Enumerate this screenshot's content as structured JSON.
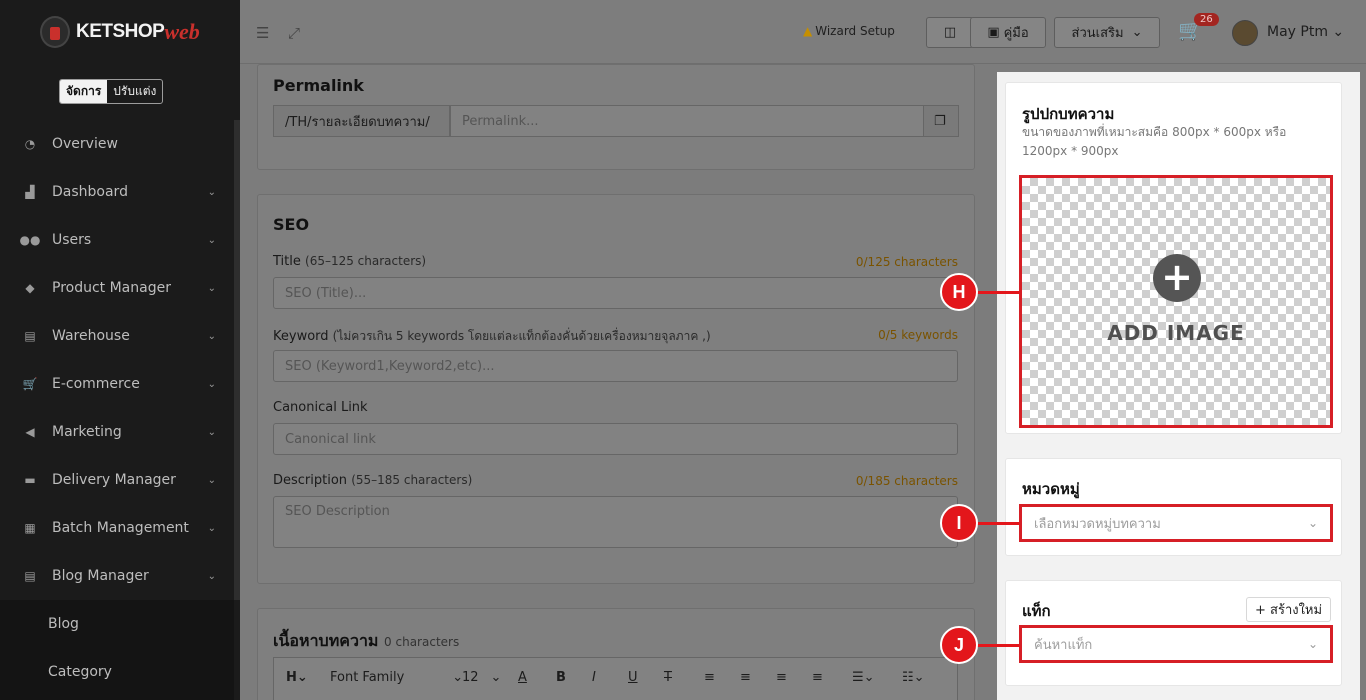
{
  "brand": {
    "name": "KETSHOP",
    "accent": "web"
  },
  "mode_toggle": {
    "manage": "จัดการ",
    "customize": "ปรับแต่ง"
  },
  "sidebar": {
    "items": [
      {
        "label": "Overview",
        "icon": "pie-chart-icon"
      },
      {
        "label": "Dashboard",
        "icon": "bar-chart-icon"
      },
      {
        "label": "Users",
        "icon": "users-icon"
      },
      {
        "label": "Product Manager",
        "icon": "tag-icon"
      },
      {
        "label": "Warehouse",
        "icon": "warehouse-icon"
      },
      {
        "label": "E-commerce",
        "icon": "cart-icon"
      },
      {
        "label": "Marketing",
        "icon": "megaphone-icon"
      },
      {
        "label": "Delivery Manager",
        "icon": "truck-icon"
      },
      {
        "label": "Batch Management",
        "icon": "boxes-icon"
      },
      {
        "label": "Blog Manager",
        "icon": "blog-icon"
      }
    ],
    "sub_items": [
      {
        "label": "Blog"
      },
      {
        "label": "Category"
      }
    ]
  },
  "topbar": {
    "wizard": "Wizard Setup",
    "manual": "คู่มือ",
    "addons": "ส่วนเสริม",
    "cart_count": "26",
    "user": "May Ptm"
  },
  "permalink": {
    "title": "Permalink",
    "prefix": "/TH/รายละเอียดบทความ/",
    "placeholder": "Permalink..."
  },
  "seo": {
    "title": "SEO",
    "title_label": "Title",
    "title_hint": "(65–125 characters)",
    "title_counter": "0/125 characters",
    "title_placeholder": "SEO (Title)...",
    "keyword_label": "Keyword",
    "keyword_hint": "(ไม่ควรเกิน 5 keywords โดยแต่ละแท็กต้องคั่นด้วยเครื่องหมายจุลภาค ,)",
    "keyword_counter": "0/5 keywords",
    "keyword_placeholder": "SEO (Keyword1,Keyword2,etc)...",
    "canonical_label": "Canonical Link",
    "canonical_placeholder": "Canonical link",
    "description_label": "Description",
    "description_hint": "(55–185 characters)",
    "description_counter": "0/185 characters",
    "description_placeholder": "SEO Description"
  },
  "content": {
    "title": "เนื้อหาบทความ",
    "count": "0 characters",
    "font_family": "Font Family",
    "font_size": "12"
  },
  "cover": {
    "title": "รูปปกบทความ",
    "hint": "ขนาดของภาพที่เหมาะสมคือ 800px * 600px หรือ 1200px * 900px",
    "add_image": "ADD IMAGE"
  },
  "category": {
    "title": "หมวดหมู่",
    "placeholder": "เลือกหมวดหมู่บทความ"
  },
  "tag": {
    "title": "แท็ก",
    "new_button": "+ สร้างใหม่",
    "placeholder": "ค้นหาแท็ก"
  },
  "markers": {
    "h": "H",
    "i": "I",
    "j": "J"
  },
  "colors": {
    "highlight": "#d61f26",
    "marker": "#e3161b",
    "counter": "#e0a100"
  }
}
